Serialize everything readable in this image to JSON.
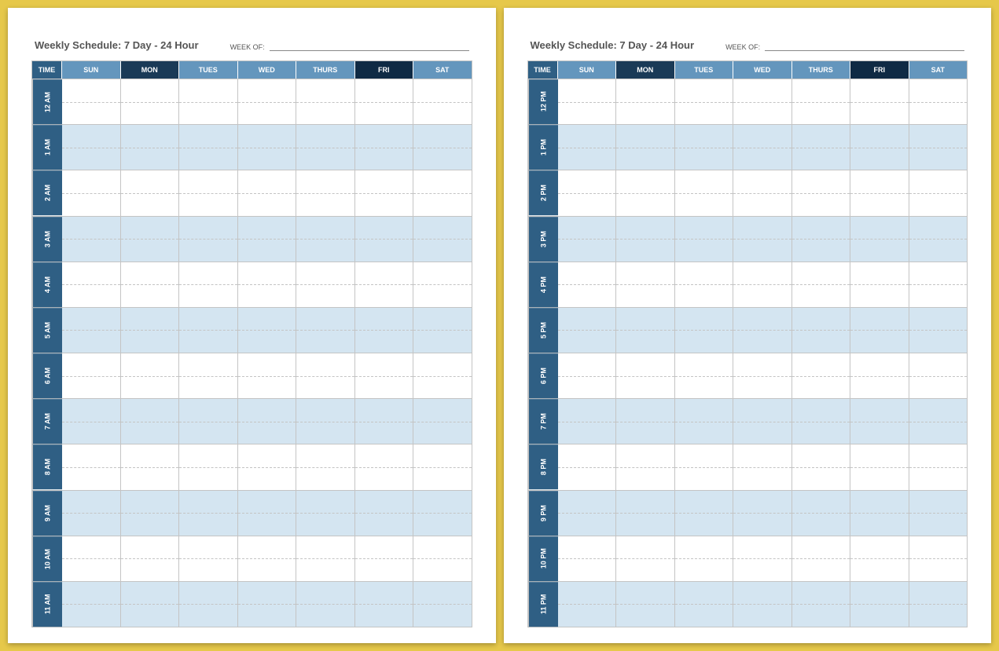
{
  "title": "Weekly Schedule: 7 Day - 24 Hour",
  "week_of_label": "WEEK OF:",
  "week_of_value": "",
  "header": {
    "time": "TIME",
    "days": [
      "SUN",
      "MON",
      "TUES",
      "WED",
      "THURS",
      "FRI",
      "SAT"
    ]
  },
  "header_colors": [
    "c-light",
    "c-dark1",
    "c-light",
    "c-light",
    "c-light",
    "c-dark2",
    "c-light"
  ],
  "pages": [
    {
      "hours": [
        "12 AM",
        "1 AM",
        "2 AM",
        "3 AM",
        "4 AM",
        "5 AM",
        "6 AM",
        "7 AM",
        "8 AM",
        "9 AM",
        "10 AM",
        "11 AM"
      ]
    },
    {
      "hours": [
        "12 PM",
        "1 PM",
        "2 PM",
        "3 PM",
        "4 PM",
        "5 PM",
        "6 PM",
        "7 PM",
        "8 PM",
        "9 PM",
        "10 PM",
        "11 PM"
      ]
    }
  ]
}
